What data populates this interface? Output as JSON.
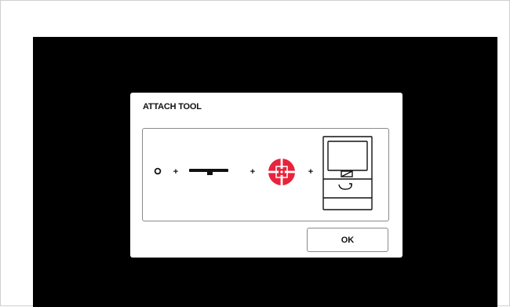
{
  "dialog": {
    "title": "ATTACH TOOL",
    "ok_label": "OK"
  },
  "diagram": {
    "steps": [
      "ring-icon",
      "blade-bar-icon",
      "saw-blade-icon",
      "device-icon"
    ],
    "separator": "+",
    "icons": {
      "ring": "ring-icon",
      "blade_bar": "blade-bar-icon",
      "saw_blade": "saw-blade-icon",
      "device": "device-icon"
    }
  },
  "colors": {
    "screen_background": "#000000",
    "dialog_background": "#ffffff",
    "accent_red": "#e8233c",
    "stroke": "#111111",
    "panel_border": "#8a8a8a"
  }
}
